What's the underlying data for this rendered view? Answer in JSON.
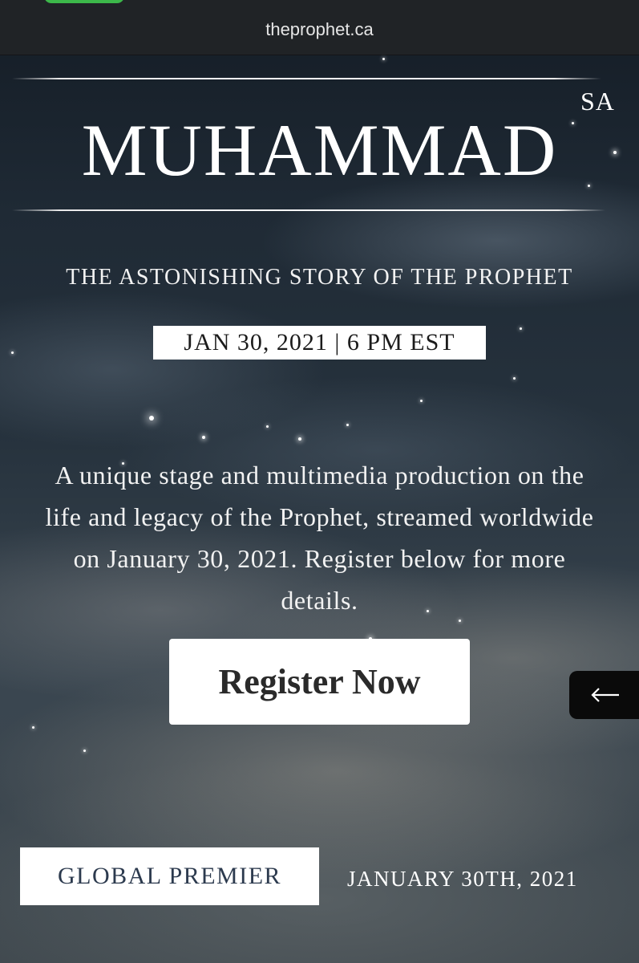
{
  "browser": {
    "url": "theprophet.ca"
  },
  "hero": {
    "superscript": "SA",
    "title": "MUHAMMAD",
    "subtitle": "THE ASTONISHING STORY OF THE PROPHET",
    "date_time": "JAN 30, 2021 | 6 PM EST"
  },
  "description": {
    "lines": [
      "A unique stage and multimedia production on the",
      "life and legacy of the Prophet, streamed worldwide",
      "on January 30, 2021. Register below for more",
      "details."
    ]
  },
  "cta": {
    "register_label": "Register Now"
  },
  "side_tab": {
    "icon": "left-arrow-icon"
  },
  "footer": {
    "premier_label": "GLOBAL PREMIER",
    "premier_date": "JANUARY 30TH, 2021"
  },
  "colors": {
    "browser_bar": "#202326",
    "url_text": "#e6e6e6",
    "button_bg": "#ffffff",
    "button_text": "#2a2a2a",
    "premier_text": "#2c3a4e",
    "side_tab_bg": "#0a0a0a"
  }
}
